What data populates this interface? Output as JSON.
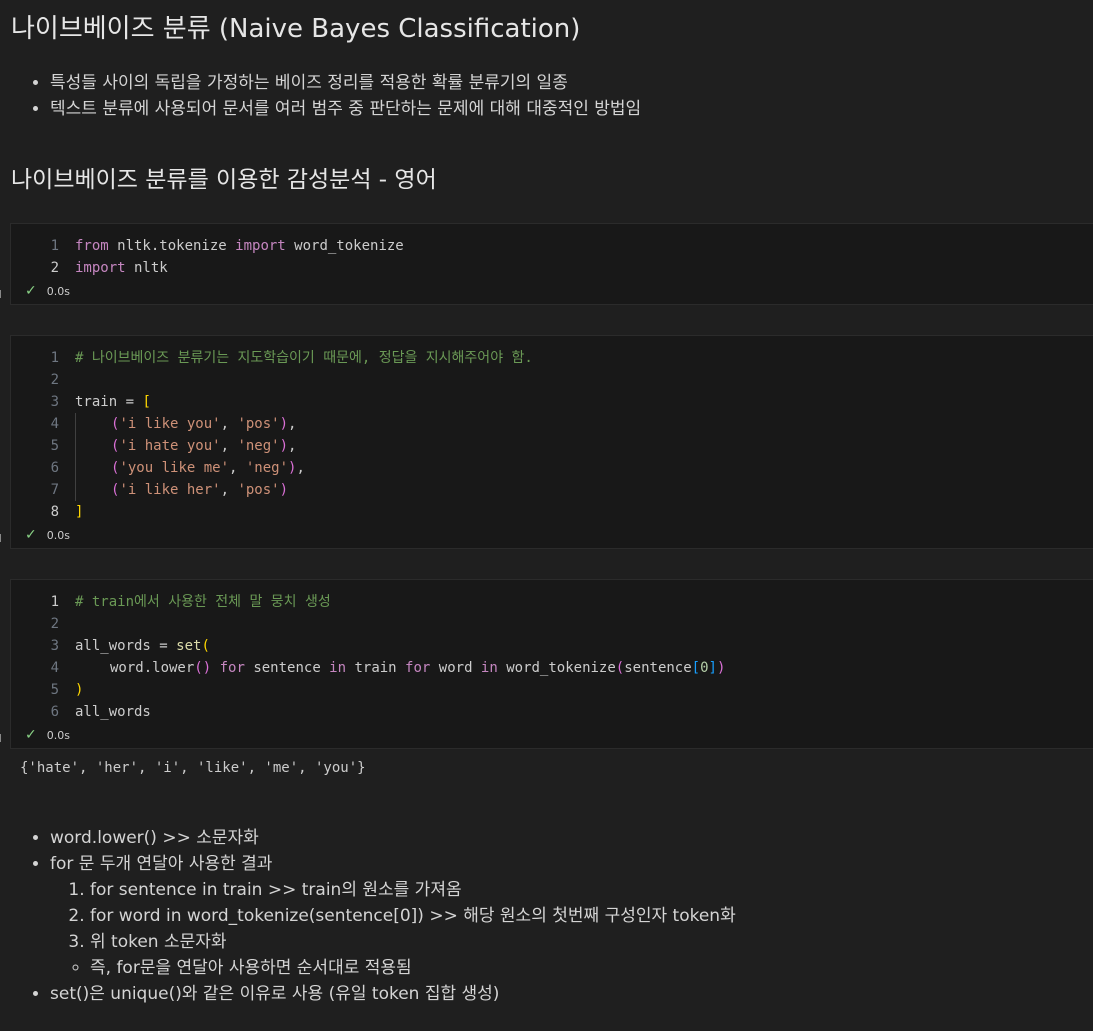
{
  "md1": {
    "title": "나이브베이즈 분류 (Naive Bayes Classification)",
    "bullets": [
      "특성들 사이의 독립을 가정하는 베이즈 정리를 적용한 확률 분류기의 일종",
      "텍스트 분류에 사용되어 문서를 여러 범주 중 판단하는 문제에 대해 대중적인 방법임"
    ],
    "subtitle": "나이브베이즈 분류를 이용한 감성분석 - 영어"
  },
  "cells": [
    {
      "status_time": "0.0s",
      "line_numbers": [
        "1",
        "2"
      ]
    },
    {
      "status_time": "0.0s",
      "line_numbers": [
        "1",
        "2",
        "3",
        "4",
        "5",
        "6",
        "7",
        "8"
      ]
    },
    {
      "status_time": "0.0s",
      "line_numbers": [
        "1",
        "2",
        "3",
        "4",
        "5",
        "6"
      ],
      "output": "{'hate', 'her', 'i', 'like', 'me', 'you'}"
    }
  ],
  "code": {
    "c1": {
      "l1": [
        "from",
        " nltk.tokenize ",
        "import",
        " word_tokenize"
      ],
      "l2": [
        "import",
        " nltk"
      ]
    },
    "c2": {
      "l1": "# 나이브베이즈 분류기는 지도학습이기 때문에, 정답을 지시해주어야 함.",
      "l3": [
        "train = ",
        "["
      ],
      "rows": [
        [
          "'i like you'",
          "'pos'"
        ],
        [
          "'i hate you'",
          "'neg'"
        ],
        [
          "'you like me'",
          "'neg'"
        ],
        [
          "'i like her'",
          "'pos'"
        ]
      ],
      "l8": "]"
    },
    "c3": {
      "l1": "# train에서 사용한 전체 말 뭉치 생성",
      "l3": [
        "all_words = ",
        "set",
        "("
      ],
      "l4": [
        "word.lower",
        "()",
        " for ",
        "sentence",
        " in ",
        "train",
        " for ",
        "word",
        " in ",
        "word_tokenize",
        "(",
        "sentence",
        "[",
        "0",
        "]",
        ")"
      ],
      "l5": ")",
      "l6": "all_words"
    }
  },
  "md2": {
    "bullets": [
      "word.lower() >> 소문자화",
      "for 문 두개 연달아 사용한 결과",
      "set()은 unique()와 같은 이유로 사용 (유일 token 집합 생성)"
    ],
    "numbered": [
      "for sentence in train >> train의 원소를 가져옴",
      "for word in word_tokenize(sentence[0]) >> 해당 원소의 첫번째 구성인자 token화",
      "위 token 소문자화"
    ],
    "circle": [
      "즉, for문을 연달아 사용하면 순서대로 적용됨"
    ]
  }
}
